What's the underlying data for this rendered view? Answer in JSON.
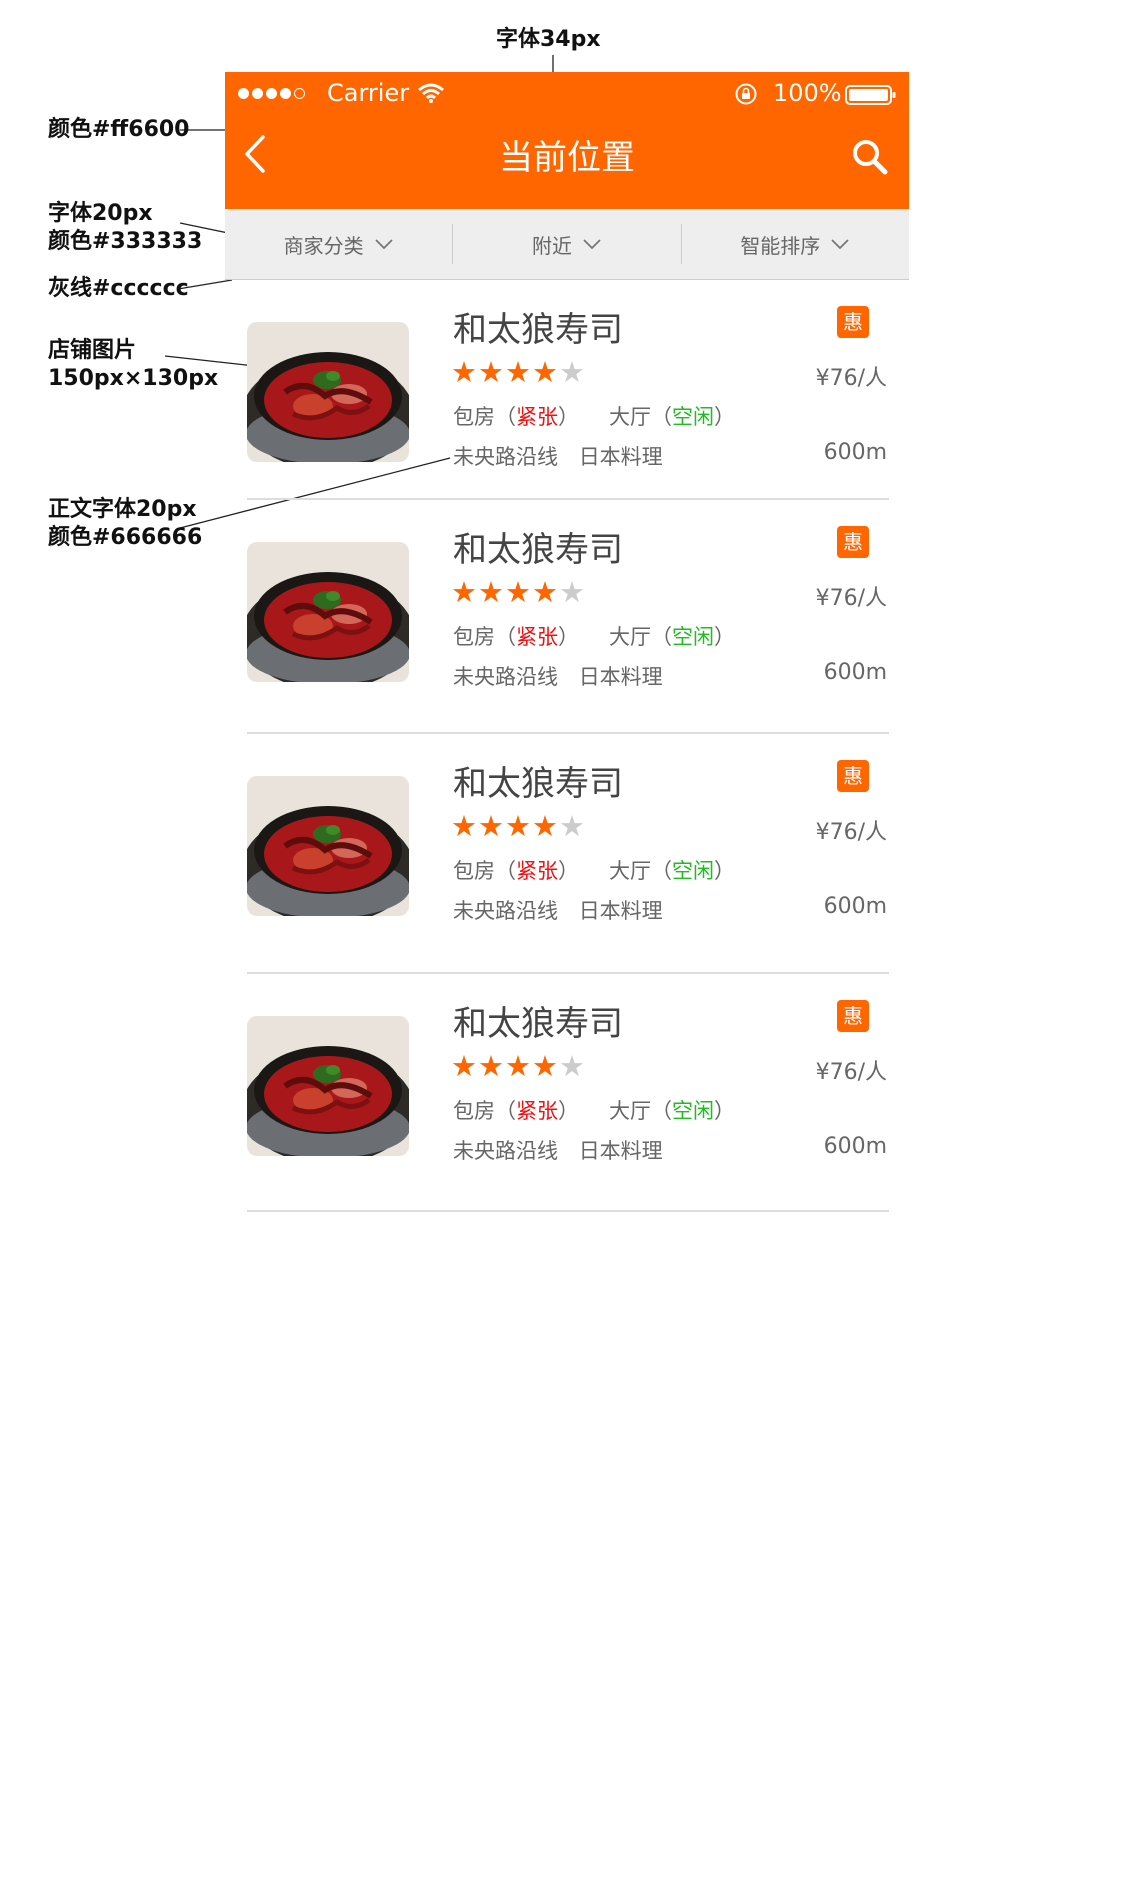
{
  "annotations": {
    "font34": "字体34px",
    "color_ff6600": "颜色#ff6600",
    "font20_line1": "字体20px",
    "font20_line2": "颜色#333333",
    "gray_line": "灰线#cccccc",
    "shop_img_line1": "店铺图片",
    "shop_img_line2": "150px×130px",
    "body_font_line1": "正文字体20px",
    "body_font_line2": "颜色#666666"
  },
  "status_bar": {
    "carrier": "Carrier",
    "battery": "100%"
  },
  "header": {
    "title": "当前位置",
    "back_icon": "chevron-left-icon",
    "search_icon": "search-icon",
    "bg_color": "#ff6600"
  },
  "filters": [
    {
      "label": "商家分类"
    },
    {
      "label": "附近"
    },
    {
      "label": "智能排序"
    }
  ],
  "shops": [
    {
      "name": "和太狼寿司",
      "badge": "惠",
      "rating": 4,
      "max_rating": 5,
      "price": "¥76/人",
      "room_label": "包房（",
      "room_status": "紧张",
      "room_close": "）",
      "hall_label": "大厅（",
      "hall_status": "空闲",
      "hall_close": "）",
      "location": "未央路沿线",
      "cuisine": "日本料理",
      "distance": "600m"
    },
    {
      "name": "和太狼寿司",
      "badge": "惠",
      "rating": 4,
      "max_rating": 5,
      "price": "¥76/人",
      "room_label": "包房（",
      "room_status": "紧张",
      "room_close": "）",
      "hall_label": "大厅（",
      "hall_status": "空闲",
      "hall_close": "）",
      "location": "未央路沿线",
      "cuisine": "日本料理",
      "distance": "600m"
    },
    {
      "name": "和太狼寿司",
      "badge": "惠",
      "rating": 4,
      "max_rating": 5,
      "price": "¥76/人",
      "room_label": "包房（",
      "room_status": "紧张",
      "room_close": "）",
      "hall_label": "大厅（",
      "hall_status": "空闲",
      "hall_close": "）",
      "location": "未央路沿线",
      "cuisine": "日本料理",
      "distance": "600m"
    },
    {
      "name": "和太狼寿司",
      "badge": "惠",
      "rating": 4,
      "max_rating": 5,
      "price": "¥76/人",
      "room_label": "包房（",
      "room_status": "紧张",
      "room_close": "）",
      "hall_label": "大厅（",
      "hall_status": "空闲",
      "hall_close": "）",
      "location": "未央路沿线",
      "cuisine": "日本料理",
      "distance": "600m"
    }
  ]
}
